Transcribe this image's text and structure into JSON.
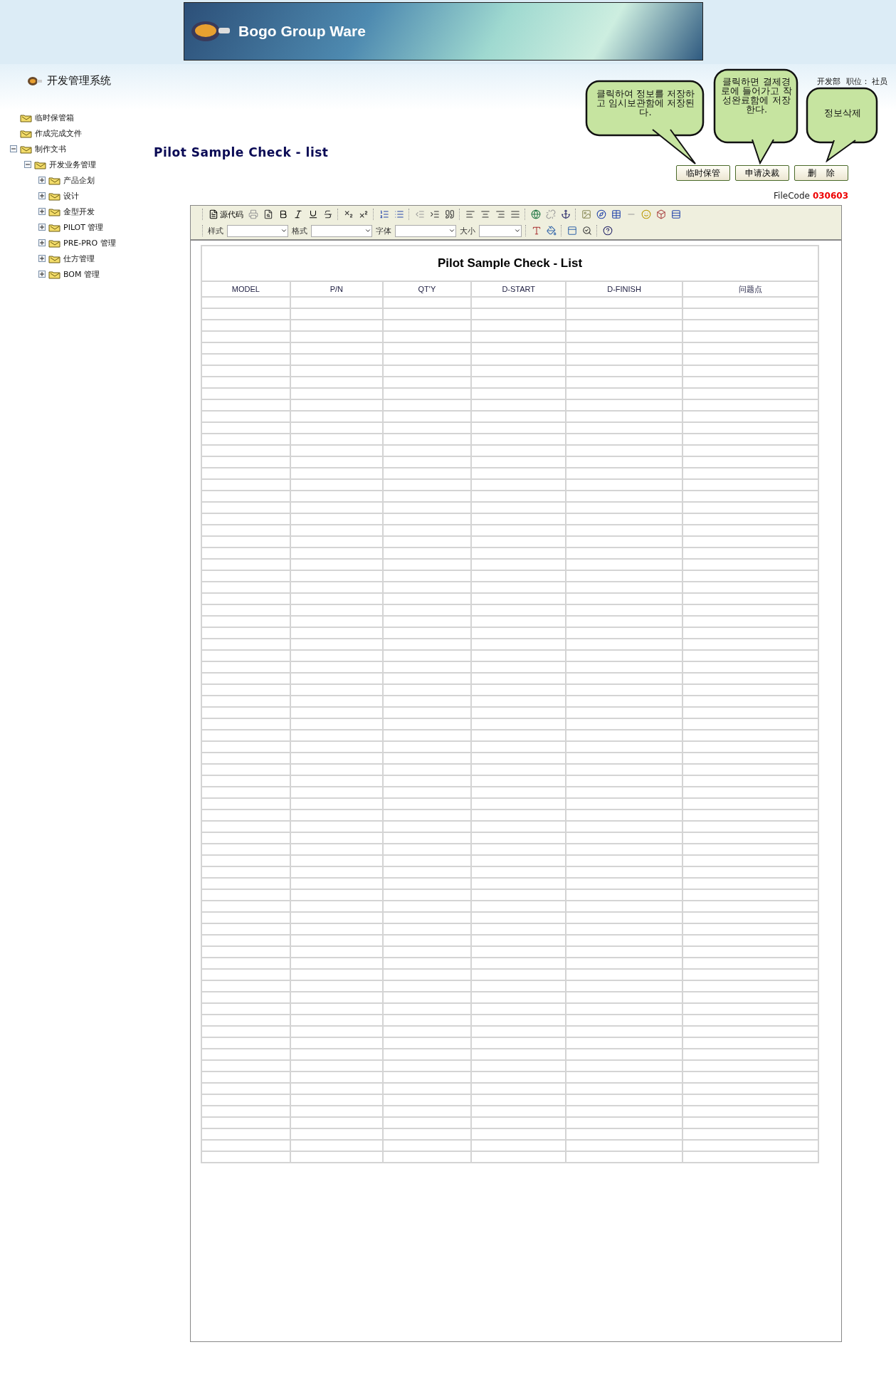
{
  "header": {
    "banner_title": "Bogo Group Ware",
    "system_title": "开发管理系统",
    "user_info": [
      "开发部",
      "职位： 社员"
    ]
  },
  "sidebar": {
    "tree": [
      {
        "label": "临时保管箱"
      },
      {
        "label": "作成完成文件"
      },
      {
        "label": "制作文书",
        "expanded": true,
        "children": [
          {
            "label": "开发业务管理",
            "expanded": true,
            "children": [
              {
                "label": "产品企划",
                "expanded": false
              },
              {
                "label": "设计",
                "expanded": false
              },
              {
                "label": "金型开发",
                "expanded": false
              },
              {
                "label": "PILOT 管理",
                "expanded": false
              },
              {
                "label": "PRE-PRO 管理",
                "expanded": false
              },
              {
                "label": "仕方管理",
                "expanded": false
              },
              {
                "label": "BOM 管理",
                "expanded": false
              }
            ]
          }
        ]
      }
    ]
  },
  "page_title": "Pilot Sample Check - list",
  "actions": [
    "临时保管",
    "申请决裁",
    "删    除"
  ],
  "callouts": [
    "클릭하여 정보를 저장하고 임시보관함에 저장된다.",
    "클릭하면 결제경로에 들어가고 작성완료함에 저장한다.",
    "정보삭제"
  ],
  "file_code": {
    "label": "FileCode",
    "value": "030603"
  },
  "editor": {
    "source_button": "源代码",
    "selects": [
      "样式",
      "格式",
      "字体",
      "大小"
    ],
    "document": {
      "title": "Pilot Sample Check - List",
      "columns": [
        "MODEL",
        "P/N",
        "QT'Y",
        "D-START",
        "D-FINISH",
        "问题点"
      ]
    }
  }
}
